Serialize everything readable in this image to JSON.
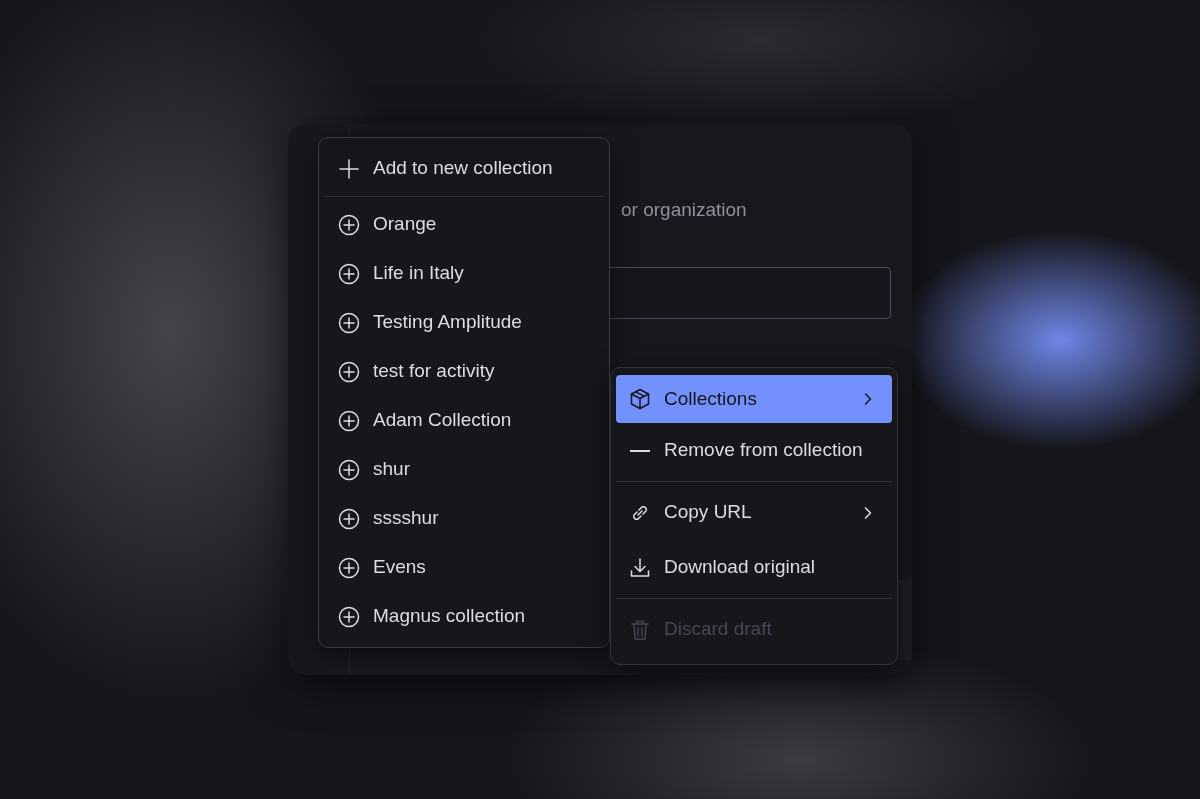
{
  "dialog": {
    "subtitle": "or organization"
  },
  "collections_menu": {
    "header": {
      "label": "Add to new collection"
    },
    "items": [
      {
        "label": "Orange"
      },
      {
        "label": "Life in Italy"
      },
      {
        "label": "Testing Amplitude"
      },
      {
        "label": "test for activity"
      },
      {
        "label": "Adam Collection"
      },
      {
        "label": "shur"
      },
      {
        "label": "sssshur"
      },
      {
        "label": "Evens"
      },
      {
        "label": "Magnus collection"
      }
    ]
  },
  "context_menu": {
    "groups": [
      [
        {
          "label": "Collections",
          "selected": true,
          "disabled": false,
          "has_submenu": true
        },
        {
          "label": "Remove from collection",
          "selected": false,
          "disabled": false,
          "has_submenu": false
        }
      ],
      [
        {
          "label": "Copy URL",
          "selected": false,
          "disabled": false,
          "has_submenu": true
        },
        {
          "label": "Download original",
          "selected": false,
          "disabled": false,
          "has_submenu": false
        }
      ],
      [
        {
          "label": "Discard draft",
          "selected": false,
          "disabled": true,
          "has_submenu": false
        }
      ]
    ]
  }
}
